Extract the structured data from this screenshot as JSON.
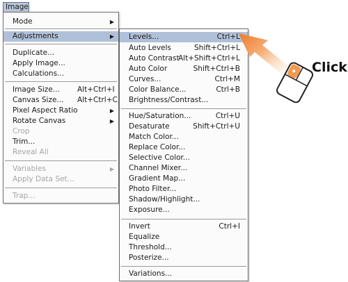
{
  "menubar": {
    "image_label": "Image"
  },
  "image_menu": {
    "mode": "Mode",
    "adjustments": "Adjustments",
    "duplicate": "Duplicate...",
    "apply_image": "Apply Image...",
    "calculations": "Calculations...",
    "image_size": "Image Size...",
    "image_size_sc": "Alt+Ctrl+I",
    "canvas_size": "Canvas Size...",
    "canvas_size_sc": "Alt+Ctrl+C",
    "pixel_aspect": "Pixel Aspect Ratio",
    "rotate_canvas": "Rotate Canvas",
    "crop": "Crop",
    "trim": "Trim...",
    "reveal_all": "Reveal All",
    "variables": "Variables",
    "apply_data_set": "Apply Data Set...",
    "trap": "Trap..."
  },
  "adjust_menu": {
    "levels": "Levels...",
    "levels_sc": "Ctrl+L",
    "auto_levels": "Auto Levels",
    "auto_levels_sc": "Shift+Ctrl+L",
    "auto_contrast": "Auto Contrast",
    "auto_contrast_sc": "Alt+Shift+Ctrl+L",
    "auto_color": "Auto Color",
    "auto_color_sc": "Shift+Ctrl+B",
    "curves": "Curves...",
    "curves_sc": "Ctrl+M",
    "color_balance": "Color Balance...",
    "color_balance_sc": "Ctrl+B",
    "brightness": "Brightness/Contrast...",
    "hue_sat": "Hue/Saturation...",
    "hue_sat_sc": "Ctrl+U",
    "desaturate": "Desaturate",
    "desaturate_sc": "Shift+Ctrl+U",
    "match_color": "Match Color...",
    "replace_color": "Replace Color...",
    "selective_color": "Selective Color...",
    "channel_mixer": "Channel Mixer...",
    "gradient_map": "Gradient Map...",
    "photo_filter": "Photo Filter...",
    "shadow_highlight": "Shadow/Highlight...",
    "exposure": "Exposure...",
    "invert": "Invert",
    "invert_sc": "Ctrl+I",
    "equalize": "Equalize",
    "threshold": "Threshold...",
    "posterize": "Posterize...",
    "variations": "Variations..."
  },
  "callout": {
    "label": "Click"
  },
  "colors": {
    "arrow": "#f08a3a",
    "highlight": "#b0c0d8"
  }
}
